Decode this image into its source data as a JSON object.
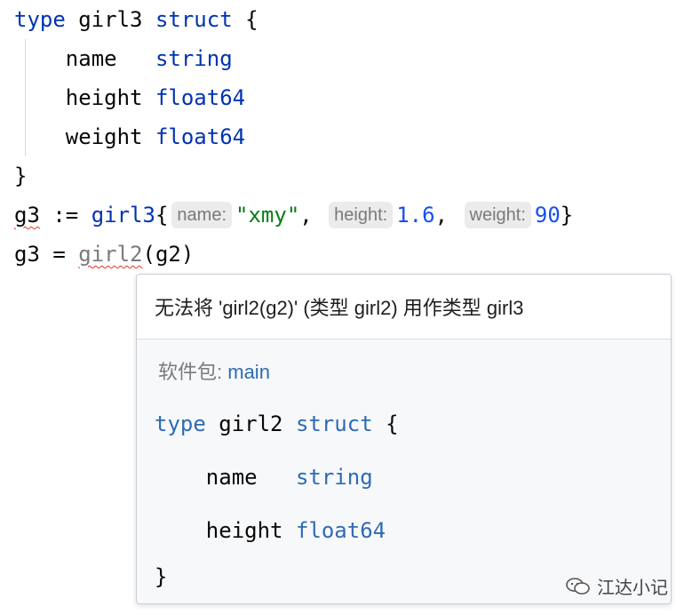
{
  "code": {
    "lines": [
      {
        "keyword": "type",
        "name": "girl3",
        "keyword2": "struct",
        "brace": "{"
      },
      {
        "field": "name",
        "pad": "   ",
        "type": "string"
      },
      {
        "field": "height",
        "pad": " ",
        "type": "float64"
      },
      {
        "field": "weight",
        "pad": " ",
        "type": "float64"
      },
      {
        "brace": "}"
      },
      {
        "var": "g3",
        "op": ":=",
        "typeref": "girl3",
        "open": "{",
        "hints": [
          "name:",
          "height:",
          "weight:"
        ],
        "values": [
          "\"xmy\"",
          "1.6",
          "90"
        ],
        "close": "}"
      },
      {
        "var": "g3",
        "op": "=",
        "call": "girl2",
        "args": "(g2)"
      }
    ]
  },
  "popup": {
    "message": "无法将 'girl2(g2)' (类型 girl2) 用作类型 girl3",
    "package_label": "软件包:",
    "package_name": "main",
    "def_keyword": "type",
    "def_name": "girl2",
    "def_keyword2": "struct",
    "def_open": "{",
    "fields": [
      {
        "name": "name",
        "pad": "   ",
        "type": "string"
      },
      {
        "name": "height",
        "pad": " ",
        "type": "float64"
      }
    ],
    "def_close": "}"
  },
  "watermark": {
    "text": "江达小记",
    "icon": "wechat-icon"
  }
}
